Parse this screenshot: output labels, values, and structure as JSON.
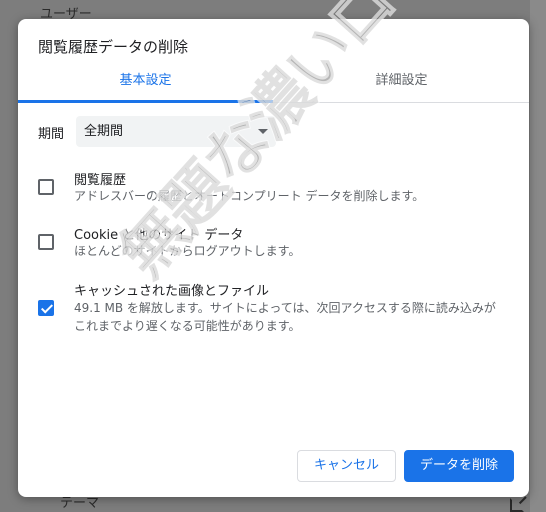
{
  "background": {
    "top_label": "ユーザー",
    "bottom_label": "テーマ"
  },
  "dialog": {
    "title": "閲覧履歴データの削除",
    "tabs": [
      {
        "label": "基本設定",
        "active": true
      },
      {
        "label": "詳細設定",
        "active": false
      }
    ],
    "period": {
      "label": "期間",
      "selected": "全期間"
    },
    "options": [
      {
        "title": "閲覧履歴",
        "description": "アドレスバーの履歴とオートコンプリート データを削除します。",
        "checked": false
      },
      {
        "title": "Cookie と他のサイト データ",
        "description": "ほとんどのサイトからログアウトします。",
        "checked": false
      },
      {
        "title": "キャッシュされた画像とファイル",
        "description": "49.1 MB を解放します。サイトによっては、次回アクセスする際に読み込みがこれまでより遅くなる可能性があります。",
        "checked": true
      }
    ],
    "buttons": {
      "cancel": "キャンセル",
      "delete": "データを削除"
    }
  },
  "watermark": "無題な濃いログ",
  "colors": {
    "accent": "#1a73e8",
    "overlay": "#7d7d7d"
  }
}
